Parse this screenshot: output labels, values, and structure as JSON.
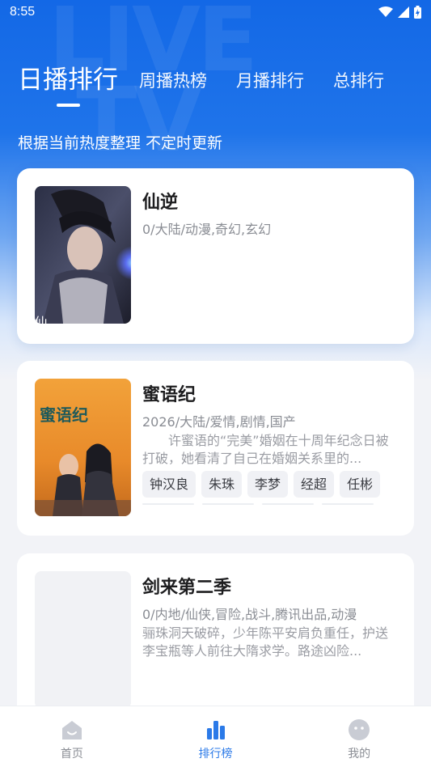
{
  "status_bar": {
    "time": "8:55"
  },
  "tabs": [
    {
      "label": "日播排行",
      "active": true
    },
    {
      "label": "周播热榜",
      "active": false
    },
    {
      "label": "月播排行",
      "active": false
    },
    {
      "label": "总排行",
      "active": false
    }
  ],
  "subtitle": "根据当前热度整理 不定时更新",
  "items": [
    {
      "title": "仙逆",
      "meta": "0/大陆/动漫,奇幻,玄幻",
      "description": "",
      "cast": [],
      "poster_label": "仙逆"
    },
    {
      "title": "蜜语纪",
      "meta": "2026/大陆/爱情,剧情,国产",
      "description": "许蜜语的“完美”婚姻在十周年纪念日被打破，她看清了自己在婚姻关系里的...",
      "cast": [
        "钟汉良",
        "朱珠",
        "李梦",
        "经超",
        "任彬"
      ],
      "poster_label": "蜜语纪"
    },
    {
      "title": "剑来第二季",
      "meta": "0/内地/仙侠,冒险,战斗,腾讯出品,动漫",
      "description": "骊珠洞天破碎，少年陈平安肩负重任，护送李宝瓶等人前往大隋求学。路途凶险...",
      "cast": [],
      "poster_label": ""
    }
  ],
  "bottom_nav": [
    {
      "label": "首页",
      "icon": "home-icon",
      "active": false
    },
    {
      "label": "排行榜",
      "icon": "bar-chart-icon",
      "active": true
    },
    {
      "label": "我的",
      "icon": "profile-icon",
      "active": false
    }
  ],
  "colors": {
    "accent": "#2b7ae8",
    "hero_blue": "#1368e6",
    "text_primary": "#1d1d1f",
    "text_secondary": "#8a8d94"
  }
}
